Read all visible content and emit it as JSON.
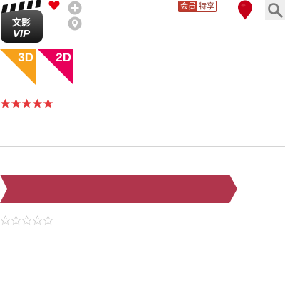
{
  "header": {
    "logo": {
      "line1": "文影",
      "line2": "VIP",
      "icon": "clapperboard-icon"
    },
    "favorite_icon": "heart-icon",
    "add_icon": "plus-circle-icon",
    "location_small_icon": "map-pin-icon",
    "member_badge": {
      "part1": "会员",
      "part2": "特享"
    },
    "location_icon": "location-marker-icon",
    "search_icon": "search-icon"
  },
  "formats": [
    {
      "label": "3D",
      "color": "#f7a11a"
    },
    {
      "label": "2D",
      "color": "#e8005a"
    }
  ],
  "rating": {
    "filled_stars": 5,
    "max_stars": 5,
    "star_color": "#e5383b"
  },
  "banner": {
    "color": "#b0354c"
  },
  "empty_rating": {
    "filled_stars": 0,
    "max_stars": 5
  },
  "colors": {
    "heart": "#e60012",
    "location": "#c40018",
    "divider": "#d4d4d4",
    "icon_gray": "#b8b8b8"
  }
}
